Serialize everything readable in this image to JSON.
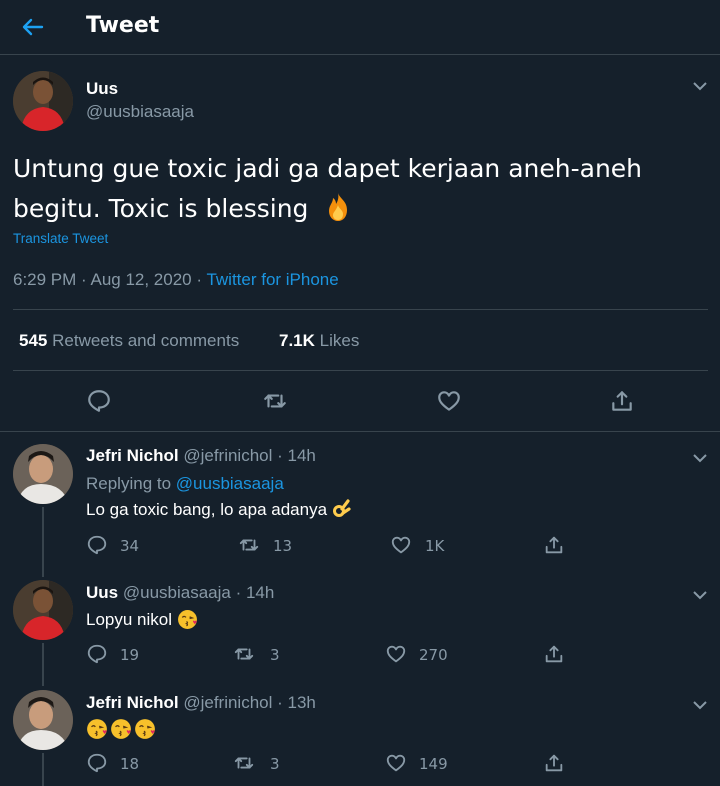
{
  "header": {
    "title": "Tweet"
  },
  "main_tweet": {
    "name": "Uus",
    "handle": "@uusbiasaaja",
    "text_line1": "Untung gue toxic jadi ga dapet kerjaan aneh-aneh",
    "text_line2": "begitu. Toxic is blessing",
    "emoji": "fire-icon",
    "translate": "Translate Tweet",
    "time": "6:29 PM · Aug 12, 2020 · ",
    "source": "Twitter for iPhone",
    "retweets_count": "545",
    "retweets_label": "Retweets and comments",
    "likes_count": "7.1K",
    "likes_label": "Likes"
  },
  "replies": [
    {
      "name": "Jefri Nichol",
      "handle": "@jefrinichol",
      "time": "· 14h",
      "replying_prefix": "Replying to ",
      "replying_to": "@uusbiasaaja",
      "text": "Lo ga toxic bang, lo apa adanya",
      "emoji": "ok-hand-icon",
      "comments": "34",
      "retweets": "13",
      "likes": "1K"
    },
    {
      "name": "Uus",
      "handle": "@uusbiasaaja",
      "time": "· 14h",
      "text": "Lopyu nikol",
      "emoji": "kiss-face-icon",
      "comments": "19",
      "retweets": "3",
      "likes": "270"
    },
    {
      "name": "Jefri Nichol",
      "handle": "@jefrinichol",
      "time": "· 13h",
      "text": "",
      "emoji": "kiss-face-icon x3",
      "comments": "18",
      "retweets": "3",
      "likes": "149"
    }
  ],
  "colors": {
    "background": "#15202b",
    "link": "#1b95e0",
    "muted": "#8899a6",
    "border": "#38444d"
  }
}
